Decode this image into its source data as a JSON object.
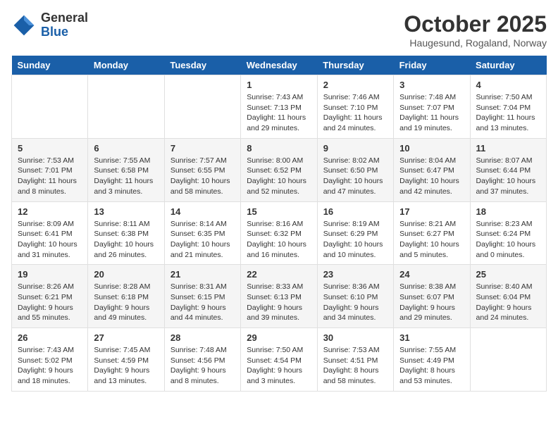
{
  "header": {
    "logo_general": "General",
    "logo_blue": "Blue",
    "month_title": "October 2025",
    "subtitle": "Haugesund, Rogaland, Norway"
  },
  "days_of_week": [
    "Sunday",
    "Monday",
    "Tuesday",
    "Wednesday",
    "Thursday",
    "Friday",
    "Saturday"
  ],
  "weeks": [
    [
      {
        "day": "",
        "info": ""
      },
      {
        "day": "",
        "info": ""
      },
      {
        "day": "",
        "info": ""
      },
      {
        "day": "1",
        "info": "Sunrise: 7:43 AM\nSunset: 7:13 PM\nDaylight: 11 hours\nand 29 minutes."
      },
      {
        "day": "2",
        "info": "Sunrise: 7:46 AM\nSunset: 7:10 PM\nDaylight: 11 hours\nand 24 minutes."
      },
      {
        "day": "3",
        "info": "Sunrise: 7:48 AM\nSunset: 7:07 PM\nDaylight: 11 hours\nand 19 minutes."
      },
      {
        "day": "4",
        "info": "Sunrise: 7:50 AM\nSunset: 7:04 PM\nDaylight: 11 hours\nand 13 minutes."
      }
    ],
    [
      {
        "day": "5",
        "info": "Sunrise: 7:53 AM\nSunset: 7:01 PM\nDaylight: 11 hours\nand 8 minutes."
      },
      {
        "day": "6",
        "info": "Sunrise: 7:55 AM\nSunset: 6:58 PM\nDaylight: 11 hours\nand 3 minutes."
      },
      {
        "day": "7",
        "info": "Sunrise: 7:57 AM\nSunset: 6:55 PM\nDaylight: 10 hours\nand 58 minutes."
      },
      {
        "day": "8",
        "info": "Sunrise: 8:00 AM\nSunset: 6:52 PM\nDaylight: 10 hours\nand 52 minutes."
      },
      {
        "day": "9",
        "info": "Sunrise: 8:02 AM\nSunset: 6:50 PM\nDaylight: 10 hours\nand 47 minutes."
      },
      {
        "day": "10",
        "info": "Sunrise: 8:04 AM\nSunset: 6:47 PM\nDaylight: 10 hours\nand 42 minutes."
      },
      {
        "day": "11",
        "info": "Sunrise: 8:07 AM\nSunset: 6:44 PM\nDaylight: 10 hours\nand 37 minutes."
      }
    ],
    [
      {
        "day": "12",
        "info": "Sunrise: 8:09 AM\nSunset: 6:41 PM\nDaylight: 10 hours\nand 31 minutes."
      },
      {
        "day": "13",
        "info": "Sunrise: 8:11 AM\nSunset: 6:38 PM\nDaylight: 10 hours\nand 26 minutes."
      },
      {
        "day": "14",
        "info": "Sunrise: 8:14 AM\nSunset: 6:35 PM\nDaylight: 10 hours\nand 21 minutes."
      },
      {
        "day": "15",
        "info": "Sunrise: 8:16 AM\nSunset: 6:32 PM\nDaylight: 10 hours\nand 16 minutes."
      },
      {
        "day": "16",
        "info": "Sunrise: 8:19 AM\nSunset: 6:29 PM\nDaylight: 10 hours\nand 10 minutes."
      },
      {
        "day": "17",
        "info": "Sunrise: 8:21 AM\nSunset: 6:27 PM\nDaylight: 10 hours\nand 5 minutes."
      },
      {
        "day": "18",
        "info": "Sunrise: 8:23 AM\nSunset: 6:24 PM\nDaylight: 10 hours\nand 0 minutes."
      }
    ],
    [
      {
        "day": "19",
        "info": "Sunrise: 8:26 AM\nSunset: 6:21 PM\nDaylight: 9 hours\nand 55 minutes."
      },
      {
        "day": "20",
        "info": "Sunrise: 8:28 AM\nSunset: 6:18 PM\nDaylight: 9 hours\nand 49 minutes."
      },
      {
        "day": "21",
        "info": "Sunrise: 8:31 AM\nSunset: 6:15 PM\nDaylight: 9 hours\nand 44 minutes."
      },
      {
        "day": "22",
        "info": "Sunrise: 8:33 AM\nSunset: 6:13 PM\nDaylight: 9 hours\nand 39 minutes."
      },
      {
        "day": "23",
        "info": "Sunrise: 8:36 AM\nSunset: 6:10 PM\nDaylight: 9 hours\nand 34 minutes."
      },
      {
        "day": "24",
        "info": "Sunrise: 8:38 AM\nSunset: 6:07 PM\nDaylight: 9 hours\nand 29 minutes."
      },
      {
        "day": "25",
        "info": "Sunrise: 8:40 AM\nSunset: 6:04 PM\nDaylight: 9 hours\nand 24 minutes."
      }
    ],
    [
      {
        "day": "26",
        "info": "Sunrise: 7:43 AM\nSunset: 5:02 PM\nDaylight: 9 hours\nand 18 minutes."
      },
      {
        "day": "27",
        "info": "Sunrise: 7:45 AM\nSunset: 4:59 PM\nDaylight: 9 hours\nand 13 minutes."
      },
      {
        "day": "28",
        "info": "Sunrise: 7:48 AM\nSunset: 4:56 PM\nDaylight: 9 hours\nand 8 minutes."
      },
      {
        "day": "29",
        "info": "Sunrise: 7:50 AM\nSunset: 4:54 PM\nDaylight: 9 hours\nand 3 minutes."
      },
      {
        "day": "30",
        "info": "Sunrise: 7:53 AM\nSunset: 4:51 PM\nDaylight: 8 hours\nand 58 minutes."
      },
      {
        "day": "31",
        "info": "Sunrise: 7:55 AM\nSunset: 4:49 PM\nDaylight: 8 hours\nand 53 minutes."
      },
      {
        "day": "",
        "info": ""
      }
    ]
  ]
}
